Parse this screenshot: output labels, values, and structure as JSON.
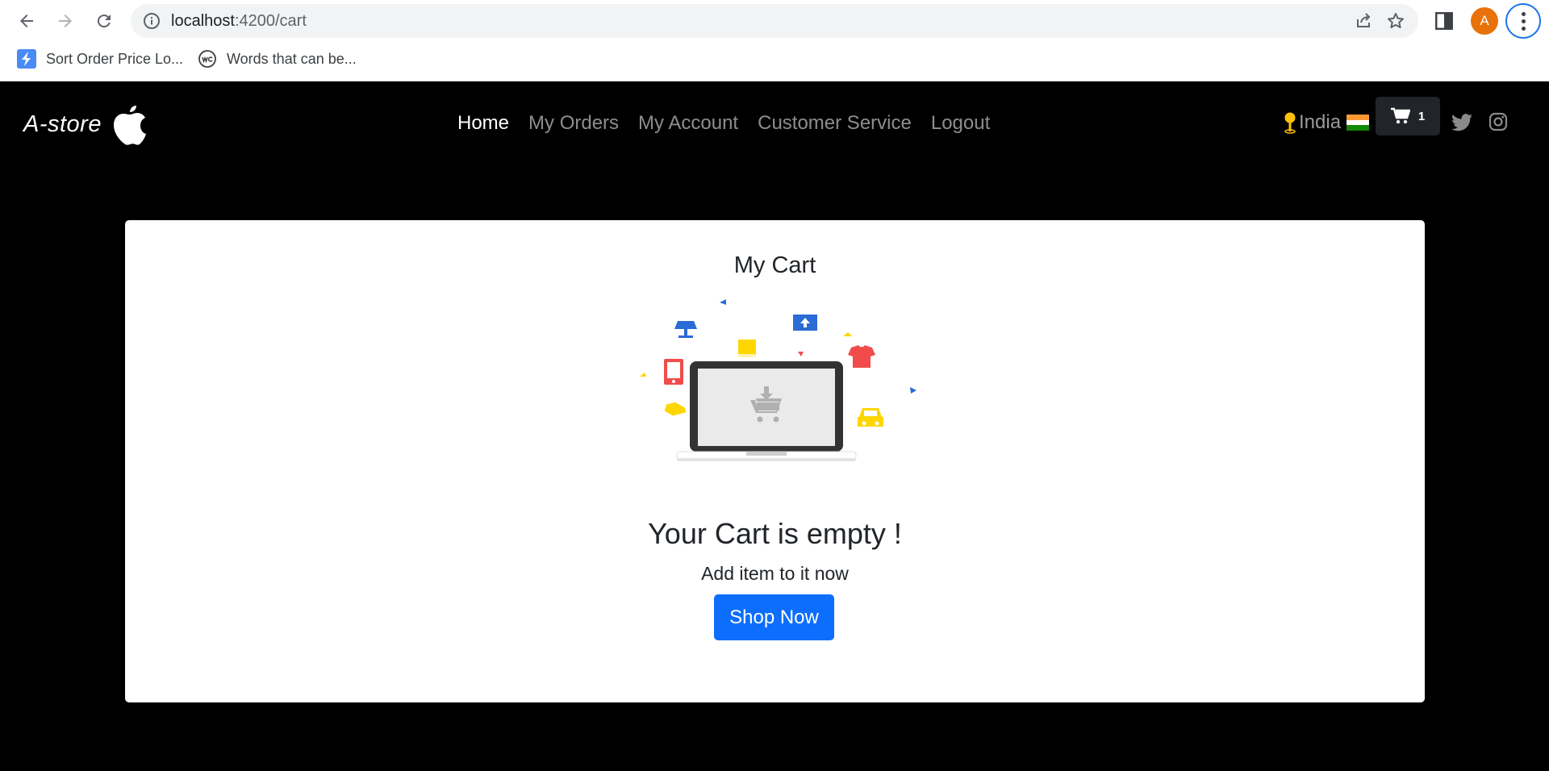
{
  "browser": {
    "url_host": "localhost",
    "url_path": ":4200/cart",
    "profile_initial": "A",
    "bookmarks": [
      {
        "label": "Sort Order Price Lo...",
        "icon": "lightning-bolt-icon"
      },
      {
        "label": "Words that can be...",
        "icon": "wc-logo-icon"
      }
    ]
  },
  "site": {
    "brand": "A-store",
    "brand_logo": "apple-logo-icon",
    "nav": [
      {
        "label": "Home",
        "active": true
      },
      {
        "label": "My Orders",
        "active": false
      },
      {
        "label": "My Account",
        "active": false
      },
      {
        "label": "Customer Service",
        "active": false
      },
      {
        "label": "Logout",
        "active": false
      }
    ],
    "location": "India",
    "cart_count": "1",
    "social": [
      "twitter-icon",
      "instagram-icon"
    ]
  },
  "cart": {
    "title": "My Cart",
    "empty_heading": "Your Cart is empty !",
    "empty_subtext": "Add item to it now",
    "shop_button": "Shop Now"
  },
  "colors": {
    "primary_button": "#0d6efd",
    "navbar_bg": "#000000",
    "cart_button_bg": "#212529",
    "illus_blue": "#2a6bd6",
    "illus_red": "#f14b4b",
    "illus_yellow": "#ffd600"
  }
}
